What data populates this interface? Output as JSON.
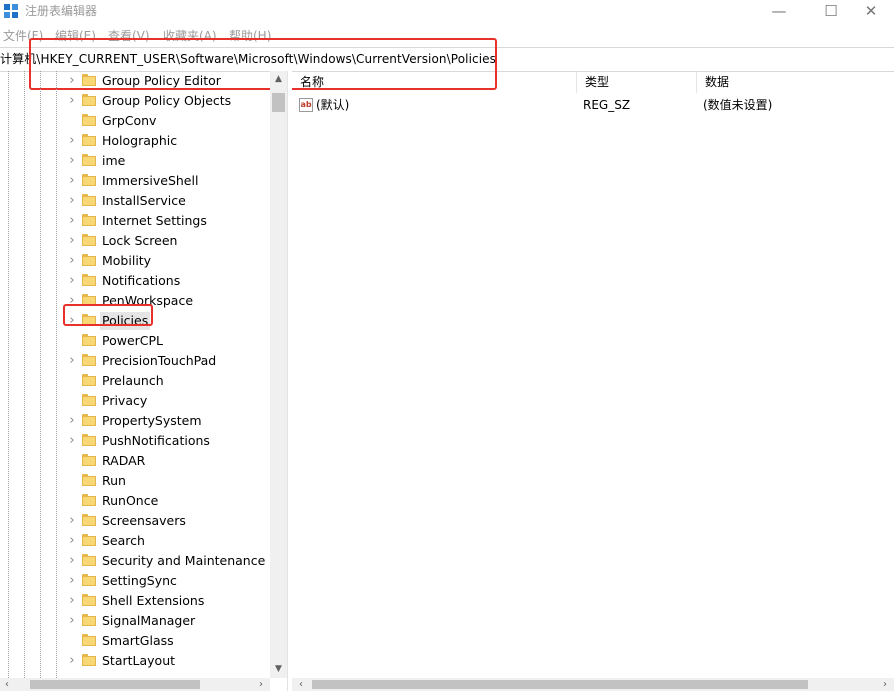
{
  "window": {
    "title": "注册表编辑器",
    "minimize_glyph": "—",
    "maximize_glyph": "☐",
    "close_glyph": "✕",
    "icon": "registry-editor-icon"
  },
  "menu": [
    "文件(F)",
    "编辑(E)",
    "查看(V)",
    "收藏夹(A)",
    "帮助(H)"
  ],
  "address": {
    "path": "计算机\\HKEY_CURRENT_USER\\Software\\Microsoft\\Windows\\CurrentVersion\\Policies"
  },
  "tree": {
    "items": [
      {
        "label": "Group Policy Editor",
        "has_children": true
      },
      {
        "label": "Group Policy Objects",
        "has_children": true
      },
      {
        "label": "GrpConv",
        "has_children": false
      },
      {
        "label": "Holographic",
        "has_children": true
      },
      {
        "label": "ime",
        "has_children": true
      },
      {
        "label": "ImmersiveShell",
        "has_children": true
      },
      {
        "label": "InstallService",
        "has_children": true
      },
      {
        "label": "Internet Settings",
        "has_children": true
      },
      {
        "label": "Lock Screen",
        "has_children": true
      },
      {
        "label": "Mobility",
        "has_children": true
      },
      {
        "label": "Notifications",
        "has_children": true
      },
      {
        "label": "PenWorkspace",
        "has_children": true
      },
      {
        "label": "Policies",
        "has_children": true,
        "selected": true
      },
      {
        "label": "PowerCPL",
        "has_children": false
      },
      {
        "label": "PrecisionTouchPad",
        "has_children": true
      },
      {
        "label": "Prelaunch",
        "has_children": false
      },
      {
        "label": "Privacy",
        "has_children": false
      },
      {
        "label": "PropertySystem",
        "has_children": true
      },
      {
        "label": "PushNotifications",
        "has_children": true
      },
      {
        "label": "RADAR",
        "has_children": false
      },
      {
        "label": "Run",
        "has_children": false
      },
      {
        "label": "RunOnce",
        "has_children": false
      },
      {
        "label": "Screensavers",
        "has_children": true
      },
      {
        "label": "Search",
        "has_children": true
      },
      {
        "label": "Security and Maintenance",
        "has_children": true
      },
      {
        "label": "SettingSync",
        "has_children": true
      },
      {
        "label": "Shell Extensions",
        "has_children": true
      },
      {
        "label": "SignalManager",
        "has_children": true
      },
      {
        "label": "SmartGlass",
        "has_children": false
      },
      {
        "label": "StartLayout",
        "has_children": true
      }
    ]
  },
  "list": {
    "columns": [
      "名称",
      "类型",
      "数据"
    ],
    "rows": [
      {
        "icon": "string-value-icon",
        "icon_text": "ab",
        "name": "(默认)",
        "type": "REG_SZ",
        "data": "(数值未设置)"
      }
    ]
  },
  "colors": {
    "highlight_border": "#e8312a",
    "folder": "#f8d775",
    "selection": "#e5e5e5"
  }
}
